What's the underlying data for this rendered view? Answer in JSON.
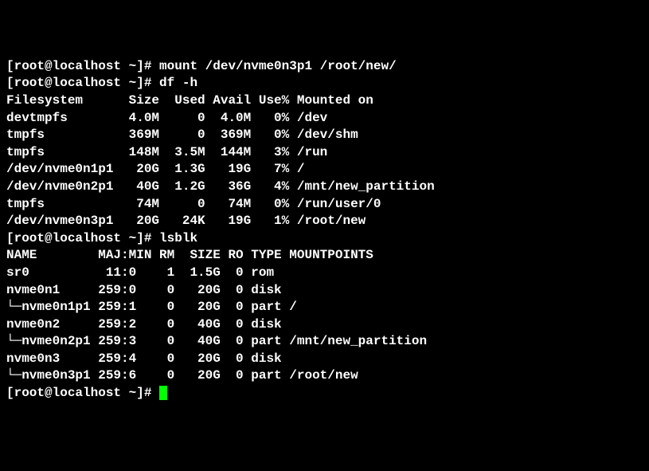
{
  "lines": {
    "p1_prompt": "[root@localhost ~]# ",
    "p1_cmd": "mount /dev/nvme0n3p1 /root/new/",
    "p2_prompt": "[root@localhost ~]# ",
    "p2_cmd": "df -h",
    "df_header": "Filesystem      Size  Used Avail Use% Mounted on",
    "df_rows": [
      "devtmpfs        4.0M     0  4.0M   0% /dev",
      "tmpfs           369M     0  369M   0% /dev/shm",
      "tmpfs           148M  3.5M  144M   3% /run",
      "/dev/nvme0n1p1   20G  1.3G   19G   7% /",
      "/dev/nvme0n2p1   40G  1.2G   36G   4% /mnt/new_partition",
      "tmpfs            74M     0   74M   0% /run/user/0",
      "/dev/nvme0n3p1   20G   24K   19G   1% /root/new"
    ],
    "p3_prompt": "[root@localhost ~]# ",
    "p3_cmd": "lsblk",
    "lsblk_header": "NAME        MAJ:MIN RM  SIZE RO TYPE MOUNTPOINTS",
    "lsblk_rows": [
      "sr0          11:0    1  1.5G  0 rom",
      "nvme0n1     259:0    0   20G  0 disk",
      "└─nvme0n1p1 259:1    0   20G  0 part /",
      "nvme0n2     259:2    0   40G  0 disk",
      "└─nvme0n2p1 259:3    0   40G  0 part /mnt/new_partition",
      "nvme0n3     259:4    0   20G  0 disk",
      "└─nvme0n3p1 259:6    0   20G  0 part /root/new"
    ],
    "p4_prompt": "[root@localhost ~]# "
  },
  "chart_data": {
    "type": "table",
    "df": {
      "columns": [
        "Filesystem",
        "Size",
        "Used",
        "Avail",
        "Use%",
        "Mounted on"
      ],
      "rows": [
        [
          "devtmpfs",
          "4.0M",
          "0",
          "4.0M",
          "0%",
          "/dev"
        ],
        [
          "tmpfs",
          "369M",
          "0",
          "369M",
          "0%",
          "/dev/shm"
        ],
        [
          "tmpfs",
          "148M",
          "3.5M",
          "144M",
          "3%",
          "/run"
        ],
        [
          "/dev/nvme0n1p1",
          "20G",
          "1.3G",
          "19G",
          "7%",
          "/"
        ],
        [
          "/dev/nvme0n2p1",
          "40G",
          "1.2G",
          "36G",
          "4%",
          "/mnt/new_partition"
        ],
        [
          "tmpfs",
          "74M",
          "0",
          "74M",
          "0%",
          "/run/user/0"
        ],
        [
          "/dev/nvme0n3p1",
          "20G",
          "24K",
          "19G",
          "1%",
          "/root/new"
        ]
      ]
    },
    "lsblk": {
      "columns": [
        "NAME",
        "MAJ:MIN",
        "RM",
        "SIZE",
        "RO",
        "TYPE",
        "MOUNTPOINTS"
      ],
      "rows": [
        [
          "sr0",
          "11:0",
          "1",
          "1.5G",
          "0",
          "rom",
          ""
        ],
        [
          "nvme0n1",
          "259:0",
          "0",
          "20G",
          "0",
          "disk",
          ""
        ],
        [
          "└─nvme0n1p1",
          "259:1",
          "0",
          "20G",
          "0",
          "part",
          "/"
        ],
        [
          "nvme0n2",
          "259:2",
          "0",
          "40G",
          "0",
          "disk",
          ""
        ],
        [
          "└─nvme0n2p1",
          "259:3",
          "0",
          "40G",
          "0",
          "part",
          "/mnt/new_partition"
        ],
        [
          "nvme0n3",
          "259:4",
          "0",
          "20G",
          "0",
          "disk",
          ""
        ],
        [
          "└─nvme0n3p1",
          "259:6",
          "0",
          "20G",
          "0",
          "part",
          "/root/new"
        ]
      ]
    }
  }
}
